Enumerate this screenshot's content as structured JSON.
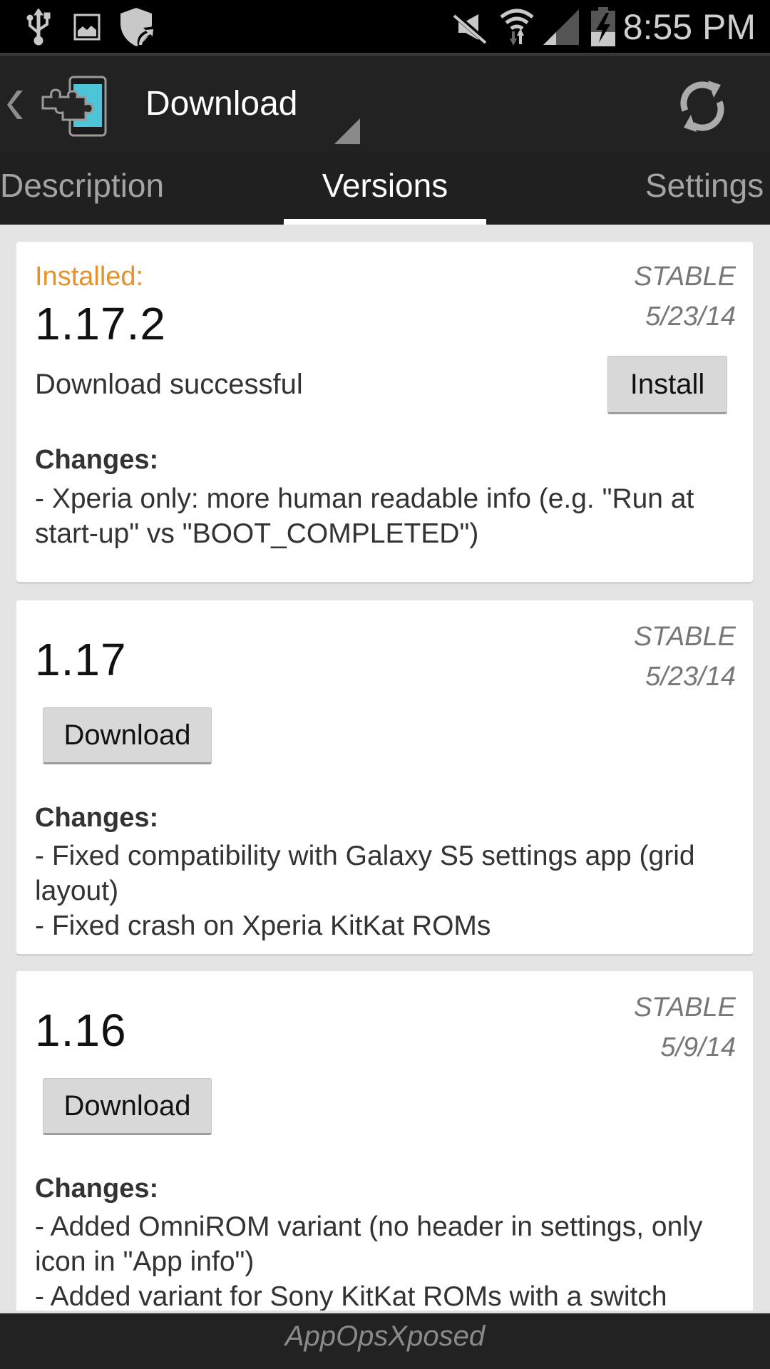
{
  "status_bar": {
    "time": "8:55 PM",
    "left_icons": [
      "usb-icon",
      "image-icon",
      "shield-update-icon"
    ],
    "right_icons": [
      "mute-icon",
      "wifi-icon",
      "signal-icon",
      "battery-charging-icon"
    ]
  },
  "action_bar": {
    "title": "Download",
    "up_icon": "chevron-left-icon",
    "app_icon": "xposed-app-icon",
    "action_icon": "refresh-icon"
  },
  "tabs": [
    {
      "label": "Description",
      "active": false
    },
    {
      "label": "Versions",
      "active": true
    },
    {
      "label": "Settings",
      "active": false
    }
  ],
  "versions": [
    {
      "installed_label": "Installed:",
      "version": "1.17.2",
      "channel": "STABLE",
      "date": "5/23/14",
      "status": "Download successful",
      "button_label": "Install",
      "changes_heading": "Changes:",
      "changes": [
        "- Xperia only: more human readable info (e.g. \"Run at start-up\" vs \"BOOT_COMPLETED\")"
      ]
    },
    {
      "version": "1.17",
      "channel": "STABLE",
      "date": "5/23/14",
      "button_label": "Download",
      "changes_heading": "Changes:",
      "changes": [
        "- Fixed compatibility with Galaxy S5 settings app (grid layout)",
        "- Fixed crash on Xperia KitKat ROMs"
      ]
    },
    {
      "version": "1.16",
      "channel": "STABLE",
      "date": "5/9/14",
      "button_label": "Download",
      "changes_heading": "Changes:",
      "changes": [
        "- Added OmniROM variant (no header in settings, only icon in \"App info\")",
        "- Added variant for Sony KitKat ROMs with a switch"
      ]
    }
  ],
  "footer": {
    "text": "AppOpsXposed"
  },
  "colors": {
    "installed_accent": "#e8902a",
    "action_bar": "#222222",
    "content_bg": "#e4e4e4",
    "tab_indicator": "#ffffff"
  }
}
